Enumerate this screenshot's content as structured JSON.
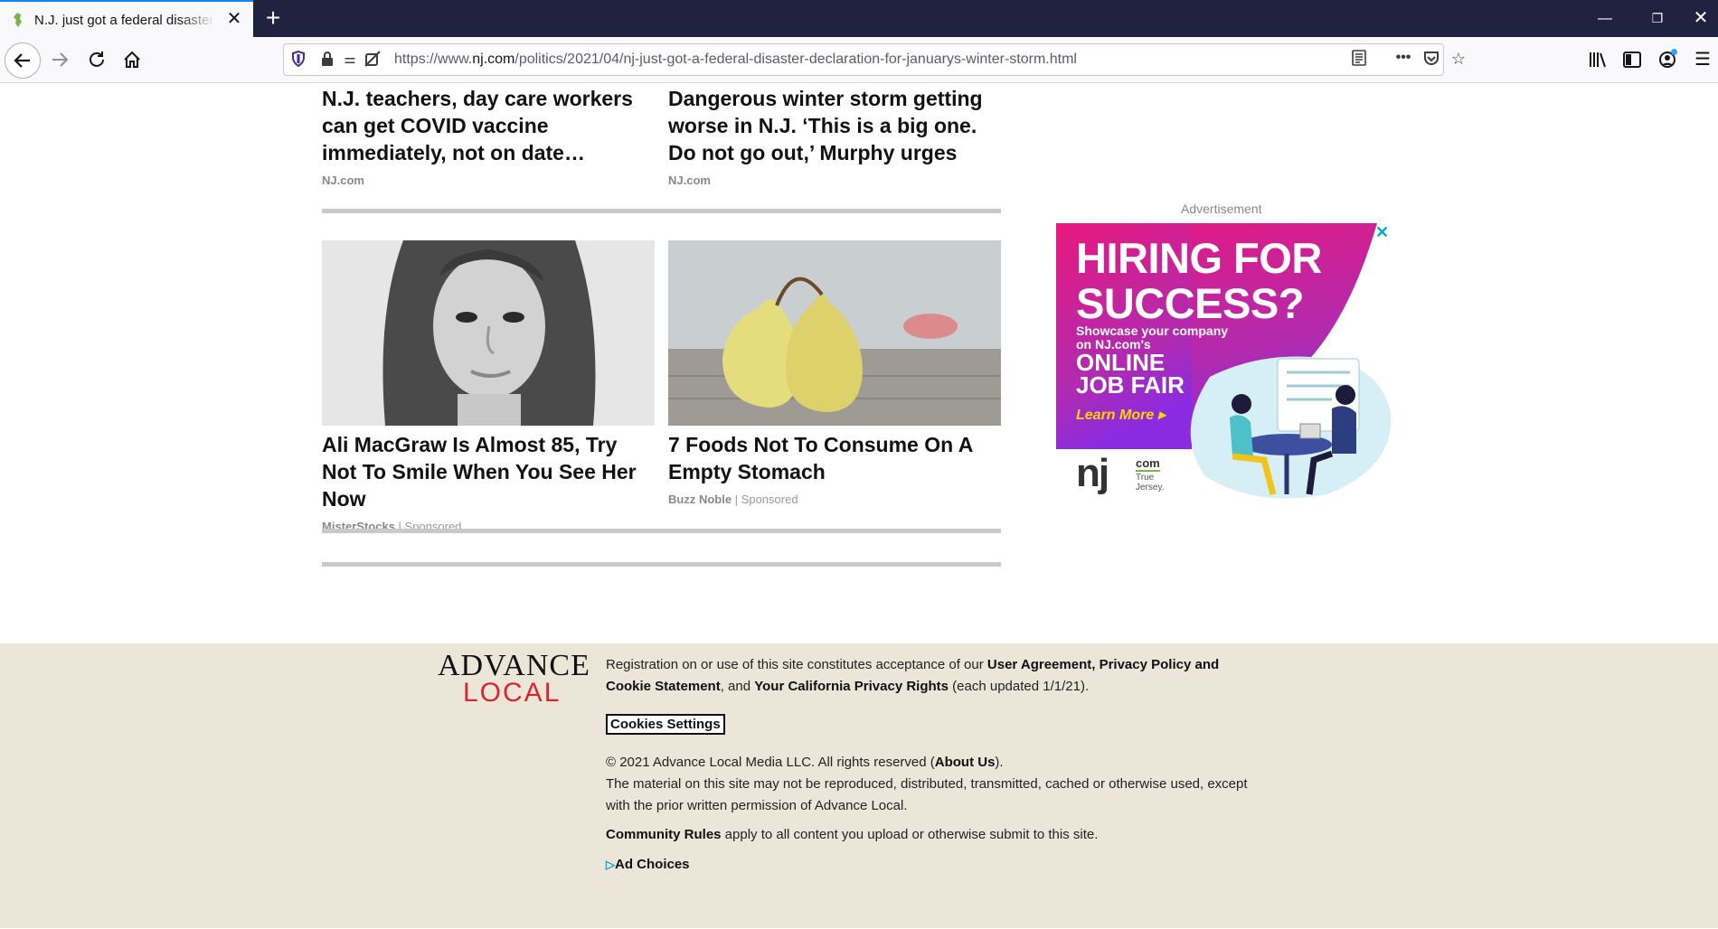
{
  "browser": {
    "tab_title": "N.J. just got a federal disaster declaration for January's winter storm",
    "url_prefix": "https://www.",
    "url_domain": "nj.com",
    "url_path": "/politics/2021/04/nj-just-got-a-federal-disaster-declaration-for-januarys-winter-storm.html",
    "icons": [
      "back-icon",
      "forward-icon",
      "reload-icon",
      "home-icon",
      "shield-icon",
      "lock-icon",
      "permissions-icon",
      "tracking-icon",
      "reader-view-icon",
      "more-icon",
      "pocket-icon",
      "bookmark-star-icon",
      "library-icon",
      "sidebar-icon",
      "account-icon",
      "menu-icon"
    ]
  },
  "articles": [
    {
      "title": "N.J. teachers, day care workers can get COVID vaccine immediately, not on date…",
      "source": "NJ.com"
    },
    {
      "title": "Dangerous winter storm getting worse in N.J. ‘This is a big one. Do not go out,’ Murphy urges",
      "source": "NJ.com"
    }
  ],
  "sponsored": [
    {
      "title": "Ali MacGraw Is Almost 85, Try Not To Smile When You See Her Now",
      "source": "MisterStocks",
      "tag": "Sponsored"
    },
    {
      "title": "7 Foods Not To Consume On A Empty Stomach",
      "source": "Buzz Noble",
      "tag": "Sponsored"
    }
  ],
  "ad": {
    "label": "Advertisement",
    "headline_1": "HIRING FOR",
    "headline_2": "SUCCESS?",
    "sub_1": "Showcase your company",
    "sub_2": "on NJ.com's",
    "fair_1": "ONLINE",
    "fair_2": "JOB FAIR",
    "cta": "Learn More ▸",
    "logo": "nj",
    "logo_com": "com",
    "logo_tag_1": "True",
    "logo_tag_2": "Jersey."
  },
  "footer": {
    "logo_line1": "ADVANCE",
    "logo_line2": "LOCAL",
    "reg_text_1": "Registration on or use of this site constitutes acceptance of our ",
    "user_agreement": "User Agreement",
    "comma": ", ",
    "privacy_policy": "Privacy Policy and Cookie Statement",
    "and_text": ", and ",
    "ca_privacy": "Your California Privacy Rights",
    "updated": " (each updated 1/1/21).",
    "cookies_settings": "Cookies Settings",
    "copyright_1": "© 2021 Advance Local Media LLC. All rights reserved (",
    "about_us": "About Us",
    "copyright_2": ").",
    "material": "The material on this site may not be reproduced, distributed, transmitted, cached or otherwise used, except with the prior written permission of Advance Local.",
    "community_rules": "Community Rules",
    "community_text": " apply to all content you upload or otherwise submit to this site.",
    "ad_choices": "Ad Choices"
  },
  "colors": {
    "chrome_dark": "#202340",
    "ad_pink": "#e8197d",
    "ad_purple": "#8a2be2",
    "advance_red": "#d8262e",
    "footer_bg": "#ebe6d8"
  }
}
